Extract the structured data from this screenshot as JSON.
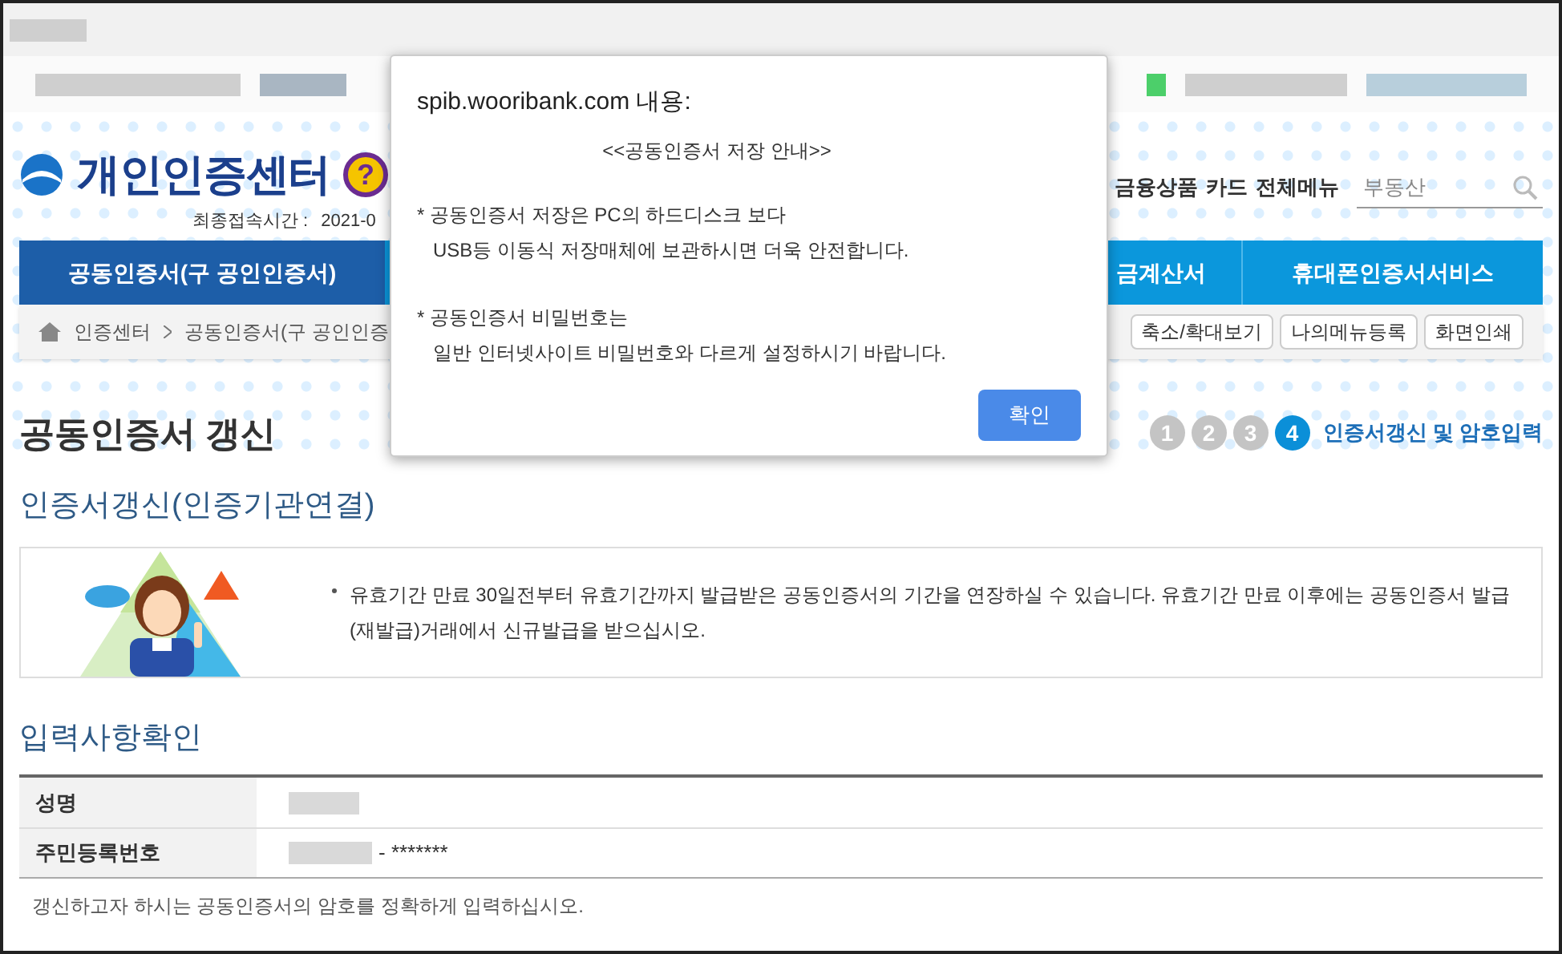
{
  "header": {
    "logo_text": "개인인증센터",
    "help_mark": "?",
    "last_access_label": "최종접속시간 :",
    "last_access_value": "2021-0",
    "top_menu": [
      "금융상품",
      "카드",
      "전체메뉴"
    ],
    "search": {
      "placeholder": "부동산"
    }
  },
  "nav": [
    {
      "label": "공동인증서(구 공인인증서)",
      "selected": true
    },
    {
      "label": "금계산서",
      "selected": false
    },
    {
      "label": "휴대폰인증서서비스",
      "selected": false
    }
  ],
  "breadcrumb": [
    "인증센터",
    "공동인증서(구 공인인증"
  ],
  "page_tools": [
    "축소/확대보기",
    "나의메뉴등록",
    "화면인쇄"
  ],
  "title": "공동인증서 갱신",
  "steps": [
    {
      "number": "1",
      "selected": false
    },
    {
      "number": "2",
      "selected": false
    },
    {
      "number": "3",
      "selected": false
    },
    {
      "number": "4",
      "selected": true
    }
  ],
  "step_label": "인증서갱신 및 암호입력",
  "section_title": "인증서갱신(인증기관연결)",
  "notice": "유효기간 만료 30일전부터 유효기간까지 발급받은 공동인증서의 기간을 연장하실 수 있습니다. 유효기간 만료 이후에는 공동인증서 발급(재발급)거래에서 신규발급을 받으십시오.",
  "confirm_title": "입력사항확인",
  "table": [
    {
      "label": "성명"
    },
    {
      "label": "주민등록번호",
      "value": "- *******"
    }
  ],
  "note": "갱신하고자 하시는 공동인증서의 암호를 정확하게 입력하십시오.",
  "dialog": {
    "title": "spib.wooribank.com 내용:",
    "heading": "<<공동인증서 저장 안내>>",
    "paragraphs": [
      [
        "* 공동인증서 저장은 PC의 하드디스크 보다",
        "USB등 이동식 저장매체에 보관하시면 더욱 안전합니다."
      ],
      [
        "* 공동인증서 비밀번호는",
        "일반 인터넷사이트 비밀번호와 다르게 설정하시기 바랍니다."
      ]
    ],
    "button": "확인"
  }
}
